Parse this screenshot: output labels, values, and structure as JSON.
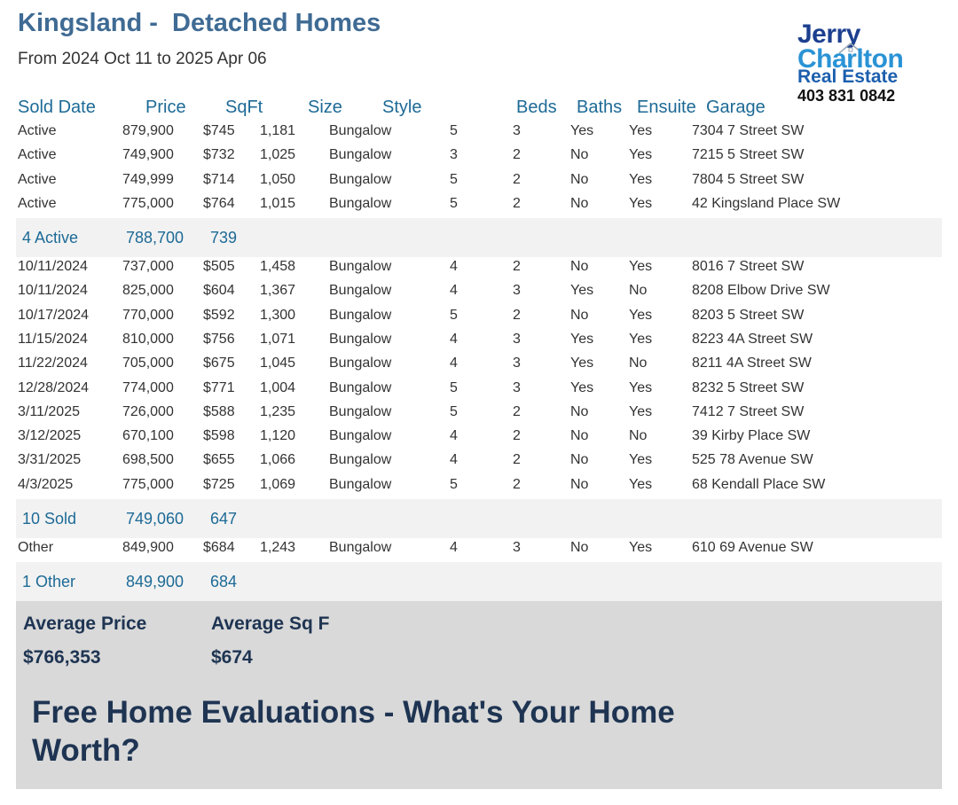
{
  "header": {
    "title": "Kingsland -  Detached Homes",
    "subtitle": "From 2024 Oct 11 to 2025 Apr 06"
  },
  "logo": {
    "line1": "Jerry",
    "line2": "Charlton",
    "line3": "Real Estate",
    "phone": "403 831 0842"
  },
  "columns": [
    "Sold Date",
    "Price",
    "SqFt",
    "Size",
    "Style",
    "Beds",
    "Baths",
    "Ensuite",
    "Garage"
  ],
  "active_rows": [
    [
      "Active",
      "879,900",
      "$745",
      "1,181",
      "Bungalow",
      "5",
      "3",
      "Yes",
      "Yes",
      "7304 7 Street SW"
    ],
    [
      "Active",
      "749,900",
      "$732",
      "1,025",
      "Bungalow",
      "3",
      "2",
      "No",
      "Yes",
      "7215 5 Street SW"
    ],
    [
      "Active",
      "749,999",
      "$714",
      "1,050",
      "Bungalow",
      "5",
      "2",
      "No",
      "Yes",
      "7804 5 Street SW"
    ],
    [
      "Active",
      "775,000",
      "$764",
      "1,015",
      "Bungalow",
      "5",
      "2",
      "No",
      "Yes",
      "42 Kingsland Place SW"
    ]
  ],
  "active_summary": {
    "label": "4 Active",
    "price": "788,700",
    "sqft": "739"
  },
  "sold_rows": [
    [
      "10/11/2024",
      "737,000",
      "$505",
      "1,458",
      "Bungalow",
      "4",
      "2",
      "No",
      "Yes",
      "8016 7 Street SW"
    ],
    [
      "10/11/2024",
      "825,000",
      "$604",
      "1,367",
      "Bungalow",
      "4",
      "3",
      "Yes",
      "No",
      "8208 Elbow Drive SW"
    ],
    [
      "10/17/2024",
      "770,000",
      "$592",
      "1,300",
      "Bungalow",
      "5",
      "2",
      "No",
      "Yes",
      "8203 5 Street SW"
    ],
    [
      "11/15/2024",
      "810,000",
      "$756",
      "1,071",
      "Bungalow",
      "4",
      "3",
      "Yes",
      "Yes",
      "8223 4A Street SW"
    ],
    [
      "11/22/2024",
      "705,000",
      "$675",
      "1,045",
      "Bungalow",
      "4",
      "3",
      "Yes",
      "No",
      "8211 4A Street SW"
    ],
    [
      "12/28/2024",
      "774,000",
      "$771",
      "1,004",
      "Bungalow",
      "5",
      "3",
      "Yes",
      "Yes",
      "8232 5 Street SW"
    ],
    [
      "3/11/2025",
      "726,000",
      "$588",
      "1,235",
      "Bungalow",
      "5",
      "2",
      "No",
      "Yes",
      "7412 7 Street SW"
    ],
    [
      "3/12/2025",
      "670,100",
      "$598",
      "1,120",
      "Bungalow",
      "4",
      "2",
      "No",
      "No",
      "39 Kirby Place SW"
    ],
    [
      "3/31/2025",
      "698,500",
      "$655",
      "1,066",
      "Bungalow",
      "4",
      "2",
      "No",
      "Yes",
      "525 78 Avenue SW"
    ],
    [
      "4/3/2025",
      "775,000",
      "$725",
      "1,069",
      "Bungalow",
      "5",
      "2",
      "No",
      "Yes",
      "68 Kendall Place SW"
    ]
  ],
  "sold_summary": {
    "label": "10 Sold",
    "price": "749,060",
    "sqft": "647"
  },
  "other_rows": [
    [
      "Other",
      "849,900",
      "$684",
      "1,243",
      "Bungalow",
      "4",
      "3",
      "No",
      "Yes",
      "610 69 Avenue SW"
    ]
  ],
  "other_summary": {
    "label": "1 Other",
    "price": "849,900",
    "sqft": "684"
  },
  "footer": {
    "avg_price_label": "Average Price",
    "avg_price_value": "$766,353",
    "avg_sqf_label": "Average Sq F",
    "avg_sqf_value": "$674",
    "promo": "Free Home Evaluations - What's Your Home Worth?"
  }
}
